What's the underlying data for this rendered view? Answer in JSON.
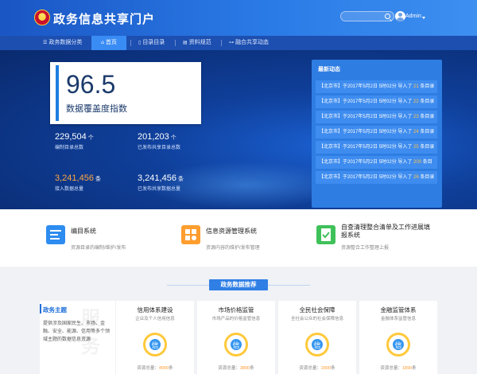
{
  "header": {
    "title": "政务信息共享门户",
    "search_placeholder": "",
    "user": "Admin"
  },
  "nav": {
    "items": [
      {
        "label": "政务数据分类",
        "icon": "list-icon"
      },
      {
        "label": "首页",
        "icon": "home-icon",
        "active": true
      },
      {
        "label": "目录目录",
        "icon": "catalog-icon"
      },
      {
        "label": "资料规范",
        "icon": "doc-icon"
      },
      {
        "label": "融合共享动态",
        "icon": "share-icon"
      }
    ]
  },
  "hero": {
    "index_value": "96.5",
    "index_label": "数据覆盖度指数",
    "stats": [
      {
        "value": "229,504",
        "unit": "个",
        "label": "编制目录总数"
      },
      {
        "value": "201,203",
        "unit": "个",
        "label": "已发布共享目录总数"
      },
      {
        "value": "3,241,456",
        "unit": "条",
        "label": "接入数据总量"
      },
      {
        "value": "3,241,456",
        "unit": "条",
        "label": "已发布共享数据总量"
      }
    ]
  },
  "news": {
    "title": "最新动态",
    "items": [
      {
        "prefix": "【北京市】于2017年5月2日 5时02分 导入了",
        "num": "21",
        "suffix": "条目录"
      },
      {
        "prefix": "【北京市】于2017年5月2日 5时02分 导入了",
        "num": "22",
        "suffix": "条目录"
      },
      {
        "prefix": "【北京市】于2017年5月2日 5时02分 导入了",
        "num": "23",
        "suffix": "条目录"
      },
      {
        "prefix": "【北京市】于2017年5月2日 5时02分 导入了",
        "num": "24",
        "suffix": "条目录"
      },
      {
        "prefix": "【北京市】于2017年5月2日 5时02分 导入了",
        "num": "25",
        "suffix": "条目录"
      },
      {
        "prefix": "【北京市】于2017年5月2日 5时02分 导入了",
        "num": "200",
        "suffix": "条目"
      },
      {
        "prefix": "【北京市】于2017年5月2日 5时02分 导入了",
        "num": "26",
        "suffix": "条目录"
      }
    ]
  },
  "systems": [
    {
      "name": "编目系统",
      "desc": "资源目录的编制/维护/发布",
      "color": "#2d8cf0"
    },
    {
      "name": "信息资源管理系统",
      "desc": "资源内容的维护/发布管理",
      "color": "#ff9d2e"
    },
    {
      "name": "自查清理整合清单及工作进展填报系统",
      "desc": "资源整合工作整理上报",
      "color": "#3fc15a"
    }
  ],
  "recommend": {
    "title": "政务数据推荐",
    "topic_title": "政务主题",
    "topic_desc": "提供涉及国家民生、市场、金融、安全、能源、信用等多个领域主题的数据信息资源",
    "topic_watermark": "服务",
    "cards": [
      {
        "title": "信用体系建设",
        "sub": "企业及个人信用信息",
        "glyph": "信",
        "total_label": "资源总量：",
        "total": "4000",
        "unit": "条"
      },
      {
        "title": "市场价格监管",
        "sub": "市场产品的价格监管信息",
        "glyph": "信",
        "total_label": "资源总量：",
        "total": "3800",
        "unit": "条"
      },
      {
        "title": "全民社会保障",
        "sub": "全社会公众的社会保障信息",
        "glyph": "信",
        "total_label": "资源总量：",
        "total": "2000",
        "unit": "条"
      },
      {
        "title": "金融监管体系",
        "sub": "金融体系监管信息",
        "glyph": "信",
        "total_label": "资源总量：",
        "total": "1890",
        "unit": "条"
      }
    ]
  }
}
